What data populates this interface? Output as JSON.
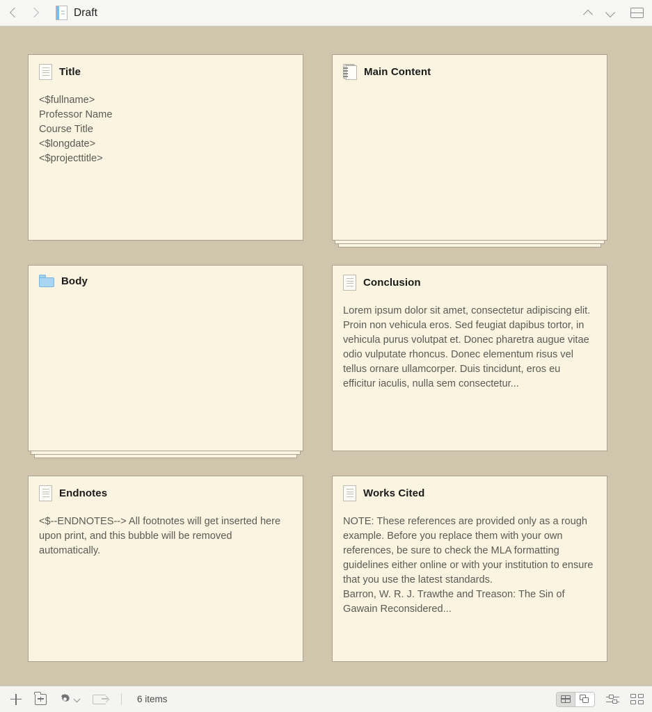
{
  "topbar": {
    "back_icon": "chevron-left-icon",
    "forward_icon": "chevron-right-icon",
    "doc_icon": "document-icon",
    "title": "Draft",
    "up_icon": "chevron-up-icon",
    "down_icon": "chevron-down-icon",
    "splitview_icon": "split-view-icon"
  },
  "board": {
    "cards": [
      {
        "icon": "document-icon",
        "icon_type": "doc",
        "title": "Title",
        "text": "<$fullname>\nProfessor Name\nCourse Title\n<$longdate>\n<$projecttitle>",
        "stacked": false
      },
      {
        "icon": "notebook-stack-icon",
        "icon_type": "notebook",
        "title": "Main Content",
        "text": "",
        "stacked": true
      },
      {
        "icon": "folder-icon",
        "icon_type": "folder",
        "title": "Body",
        "text": "",
        "stacked": true
      },
      {
        "icon": "document-icon",
        "icon_type": "doc",
        "title": "Conclusion",
        "text": "Lorem ipsum dolor sit amet, consectetur adipiscing elit. Proin non vehicula eros. Sed feugiat dapibus tortor, in vehicula purus volutpat et. Donec pharetra augue vitae odio vulputate rhoncus. Donec elementum risus vel tellus ornare ullamcorper. Duis tincidunt, eros eu efficitur iaculis, nulla sem consectetur...",
        "stacked": false
      },
      {
        "icon": "document-icon",
        "icon_type": "doc",
        "title": "Endnotes",
        "text": "<$--ENDNOTES--> All footnotes will get inserted here upon print, and this bubble will be removed automatically.",
        "stacked": false
      },
      {
        "icon": "document-icon",
        "icon_type": "doc",
        "title": "Works Cited",
        "text": "NOTE: These references are provided only as a rough example. Before you replace them with your own references, be sure to check the MLA formatting guidelines either online or with your institution to ensure that you use the latest standards.\nBarron, W. R. J. Trawthe and Treason: The Sin of Gawain Reconsidered...",
        "stacked": false
      }
    ]
  },
  "bottombar": {
    "add_icon": "plus-icon",
    "new_folder_icon": "new-folder-icon",
    "gear_icon": "gear-icon",
    "gear_chevron_icon": "chevron-down-icon",
    "export_icon": "export-arrow-icon",
    "item_count": "6 items",
    "view_grid_icon": "grid-view-icon",
    "view_cards_icon": "corkboard-view-icon",
    "selected_view": "corkboard",
    "sliders_icon": "sliders-icon",
    "layout_grid_icon": "layout-grid-icon"
  },
  "colors": {
    "board_background": "#cfc6ad",
    "card_background": "#faf4e0",
    "card_border": "#a9a192",
    "chrome": "#f4f4f2",
    "folder_blue": "#a8d5f2",
    "doc_spine_blue": "#74c0ea"
  }
}
